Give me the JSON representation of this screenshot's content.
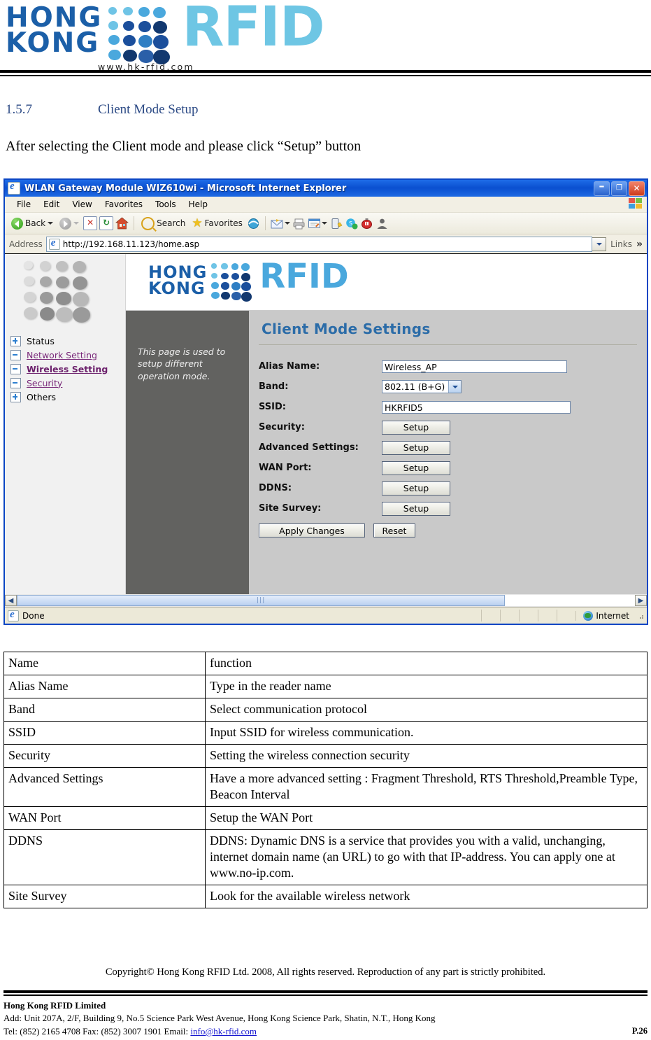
{
  "doc": {
    "logo": {
      "line1": "HONG",
      "line2": "KONG",
      "rfid": "RFID",
      "url": "www.hk-rfid.com"
    },
    "section_number": "1.5.7",
    "section_title": "Client Mode Setup",
    "intro": "After selecting the Client mode and please click “Setup” button"
  },
  "browser": {
    "title": "WLAN Gateway Module WIZ610wi - Microsoft Internet Explorer",
    "window_buttons": {
      "minimize": "–",
      "maximize": "❐",
      "close": "✕"
    },
    "menu": [
      "File",
      "Edit",
      "View",
      "Favorites",
      "Tools",
      "Help"
    ],
    "toolbar": {
      "back": "Back",
      "search": "Search",
      "favorites": "Favorites"
    },
    "address": {
      "label": "Address",
      "value": "http://192.168.11.123/home.asp",
      "links_label": "Links",
      "overflow": "»"
    },
    "status": {
      "text": "Done",
      "zone": "Internet"
    }
  },
  "webpage": {
    "brand": {
      "line1": "HONG",
      "line2": "KONG",
      "rfid": "RFID"
    },
    "nav": [
      {
        "label": "Status",
        "state": "collapsed",
        "style": "plain"
      },
      {
        "label": "Network Setting",
        "state": "expanded",
        "style": "link"
      },
      {
        "label": "Wireless Setting",
        "state": "expanded",
        "style": "active"
      },
      {
        "label": "Security",
        "state": "expanded",
        "style": "link"
      },
      {
        "label": "Others",
        "state": "collapsed",
        "style": "plain"
      }
    ],
    "description": "This page is used to setup different operation mode.",
    "form": {
      "heading": "Client Mode Settings",
      "fields": [
        {
          "label": "Alias Name:",
          "type": "text",
          "value": "Wireless_AP"
        },
        {
          "label": "Band:",
          "type": "select",
          "value": "802.11 (B+G)"
        },
        {
          "label": "SSID:",
          "type": "text",
          "value": "HKRFID5"
        },
        {
          "label": "Security:",
          "type": "button",
          "value": "Setup"
        },
        {
          "label": "Advanced Settings:",
          "type": "button",
          "value": "Setup"
        },
        {
          "label": "WAN Port:",
          "type": "button",
          "value": "Setup"
        },
        {
          "label": "DDNS:",
          "type": "button",
          "value": "Setup"
        },
        {
          "label": "Site Survey:",
          "type": "button",
          "value": "Setup"
        }
      ],
      "apply_label": "Apply Changes",
      "reset_label": "Reset"
    }
  },
  "table": {
    "headers": [
      "Name",
      "function"
    ],
    "rows": [
      [
        "Alias Name",
        "Type in the reader name"
      ],
      [
        "Band",
        "Select communication protocol"
      ],
      [
        "SSID",
        "Input SSID for wireless communication."
      ],
      [
        "Security",
        "Setting the wireless connection security"
      ],
      [
        "Advanced Settings",
        "Have a more advanced setting : Fragment Threshold, RTS Threshold,Preamble Type, Beacon Interval"
      ],
      [
        "WAN Port",
        "Setup the WAN Port"
      ],
      [
        "DDNS",
        "DDNS:  Dynamic DNS is a service that provides you with a valid, unchanging, internet domain name (an URL) to go with that IP-address. You can apply one at www.no-ip.com."
      ],
      [
        "Site Survey",
        "Look for the available  wireless network"
      ]
    ]
  },
  "footer": {
    "copyright": "Copyright© Hong Kong RFID Ltd. 2008, All rights reserved. Reproduction of any part is strictly prohibited.",
    "company": "Hong Kong RFID Limited",
    "address": "Add: Unit 207A, 2/F, Building 9, No.5 Science Park West Avenue, Hong Kong Science Park, Shatin, N.T., Hong Kong",
    "contact_prefix": "Tel: (852) 2165 4708   Fax: (852) 3007 1901   Email: ",
    "email": "info@hk-rfid.com",
    "page": "P.26"
  }
}
